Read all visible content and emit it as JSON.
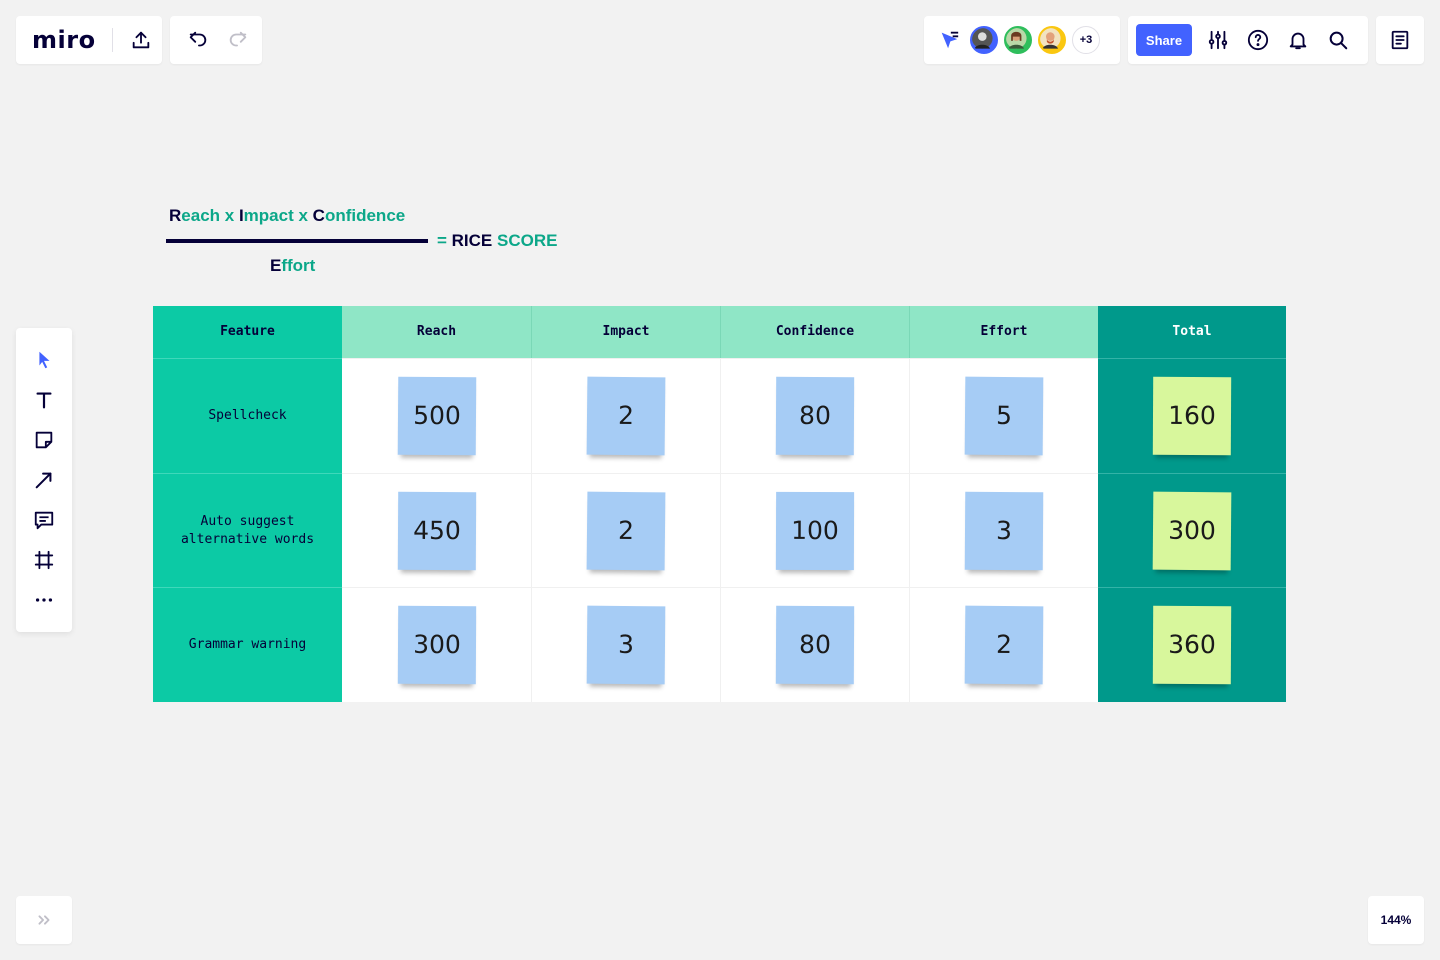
{
  "app": {
    "logo_text": "miro"
  },
  "collaborators": {
    "more_label": "+3"
  },
  "share": {
    "label": "Share"
  },
  "zoom": {
    "level": "144%"
  },
  "formula": {
    "numerator": [
      {
        "t": "R",
        "c": "navy"
      },
      {
        "t": "each x ",
        "c": "teal"
      },
      {
        "t": "I",
        "c": "navy"
      },
      {
        "t": "mpact x ",
        "c": "teal"
      },
      {
        "t": "C",
        "c": "navy"
      },
      {
        "t": "onfidence",
        "c": "teal"
      }
    ],
    "result": [
      {
        "t": "= ",
        "c": "teal"
      },
      {
        "t": "RICE ",
        "c": "navy"
      },
      {
        "t": "SCORE",
        "c": "teal"
      }
    ],
    "denominator": [
      {
        "t": "E",
        "c": "navy"
      },
      {
        "t": "ffort",
        "c": "teal"
      }
    ]
  },
  "table": {
    "headers": [
      "Feature",
      "Reach",
      "Impact",
      "Confidence",
      "Effort",
      "Total"
    ],
    "rows": [
      {
        "feature": "Spellcheck",
        "reach": "500",
        "impact": "2",
        "confidence": "80",
        "effort": "5",
        "total": "160"
      },
      {
        "feature": "Auto suggest alternative words",
        "reach": "450",
        "impact": "2",
        "confidence": "100",
        "effort": "3",
        "total": "300"
      },
      {
        "feature": "Grammar warning",
        "reach": "300",
        "impact": "3",
        "confidence": "80",
        "effort": "2",
        "total": "360"
      }
    ]
  },
  "colors": {
    "accent": "#4262ff",
    "feature_col": "#0ccaa5",
    "metric_header": "#8fe6c6",
    "total_col": "#00998b",
    "sticky_blue": "#a6ccf5",
    "sticky_yellow": "#d8f79c"
  }
}
